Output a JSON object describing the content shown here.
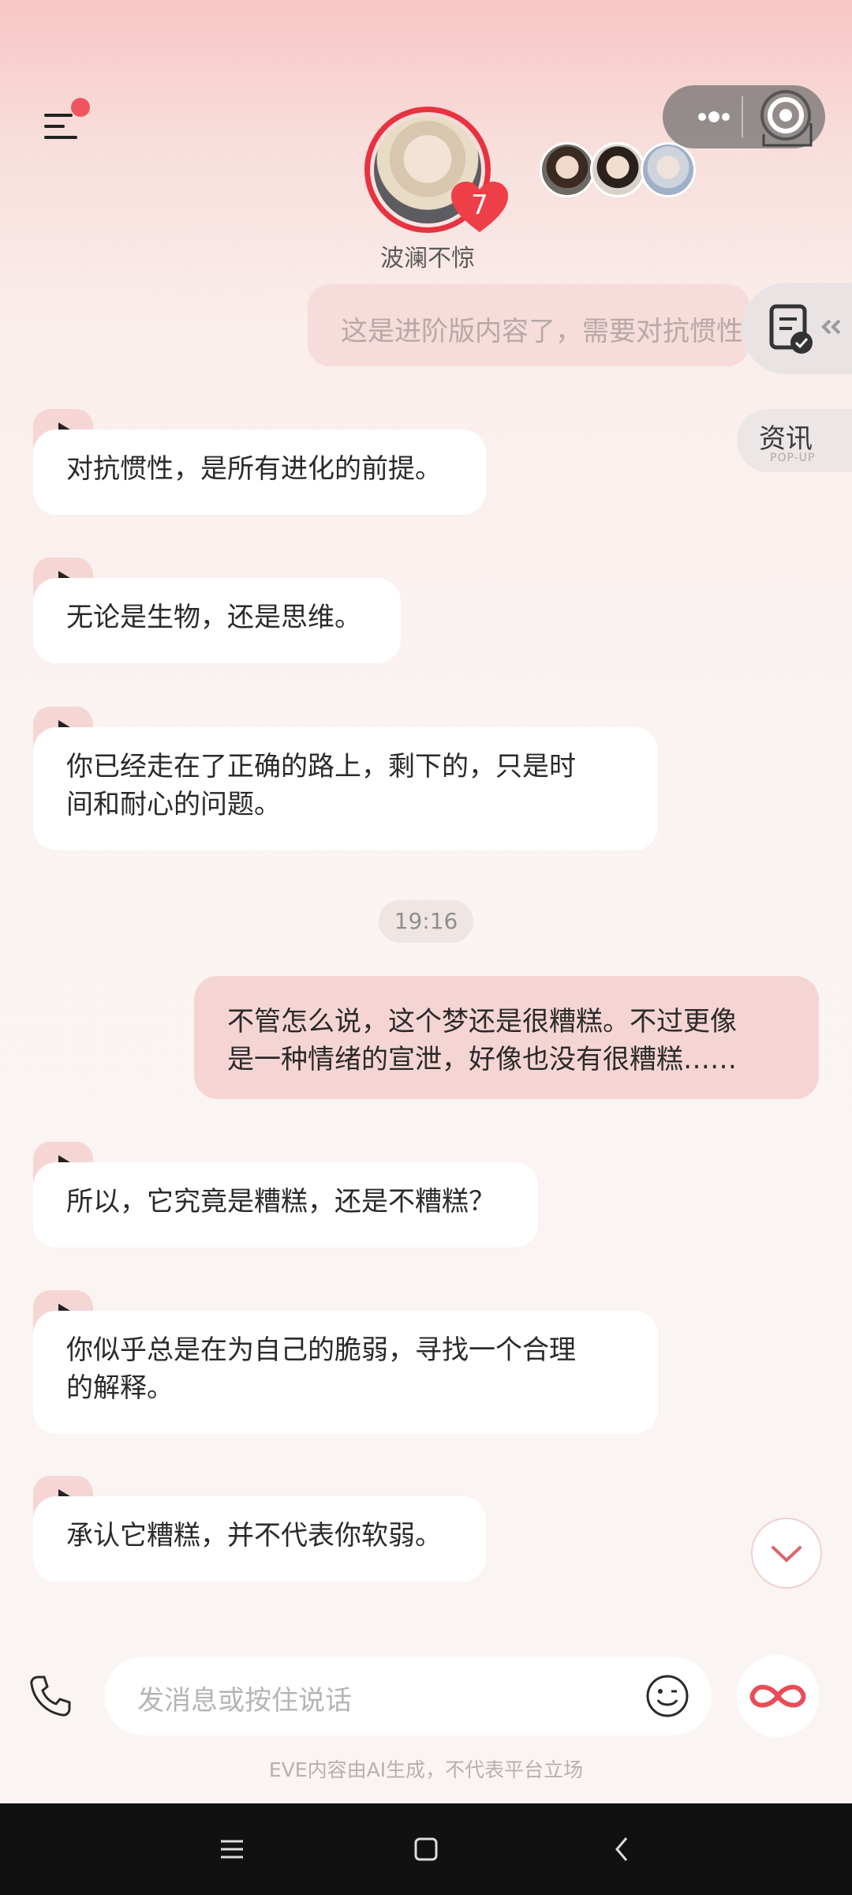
{
  "header": {
    "character_name": "波澜不惊",
    "heart_count": "7"
  },
  "side_tabs": {
    "popup_title": "资讯",
    "popup_sub": "POP-UP"
  },
  "messages": {
    "user_faded": "这是进阶版内容了，需要对抗惯性",
    "ai1": "对抗惯性，是所有进化的前提。",
    "ai2": "无论是生物，还是思维。",
    "ai3_line1": "你已经走在了正确的路上，剩下的，只是时",
    "ai3_line2": "间和耐心的问题。",
    "time": "19:16",
    "user1_line1": "不管怎么说，这个梦还是很糟糕。不过更像",
    "user1_line2": "是一种情绪的宣泄，好像也没有很糟糕……",
    "ai4": "所以，它究竟是糟糕，还是不糟糕？",
    "ai5_line1": "你似乎总是在为自己的脆弱，寻找一个合理",
    "ai5_line2": "的解释。",
    "ai6": "承认它糟糕，并不代表你软弱。"
  },
  "input": {
    "placeholder": "发消息或按住说话"
  },
  "footer": {
    "disclaimer": "EVE内容由AI生成，不代表平台立场"
  },
  "colors": {
    "accent": "#e8323f",
    "user_bubble": "#f5d5d4",
    "ai_bubble": "#ffffff"
  }
}
